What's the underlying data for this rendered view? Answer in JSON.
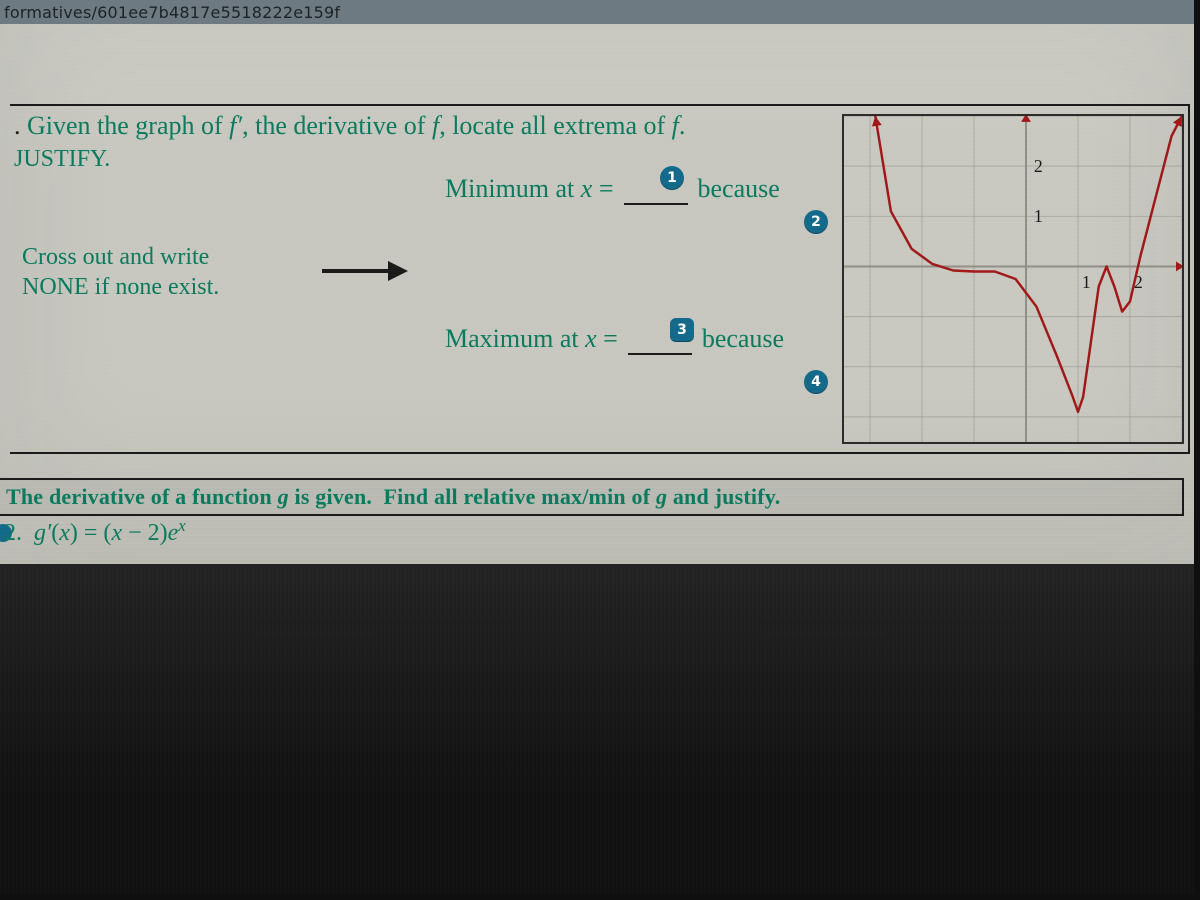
{
  "address_bar": "formatives/601ee7b4817e5518222e159f",
  "p1": {
    "prompt_prefix": ". ",
    "prompt_main": "Given the graph of f′, the derivative of f, locate all extrema of f.",
    "justify": "JUSTIFY.",
    "cross_out_l1": "Cross out and write",
    "cross_out_l2": "NONE if none exist.",
    "min_label": "Minimum at x =",
    "max_label": "Maximum at x =",
    "because": "because",
    "badges": {
      "b1": "1",
      "b2": "2",
      "b3": "3",
      "b4": "4"
    }
  },
  "p2": {
    "header": "The derivative of a function g is given.  Find all relative max/min of g and justify.",
    "num": "2.",
    "eq_lhs": "g′(x) = ",
    "eq_rhs_base": "(x − 2)e",
    "eq_rhs_exp": "x"
  },
  "chart_data": {
    "type": "line",
    "title": "",
    "xlabel": "",
    "ylabel": "",
    "xlim": [
      -3.5,
      3.0
    ],
    "ylim": [
      -3.5,
      3.0
    ],
    "x_ticks": [
      1,
      2
    ],
    "y_ticks": [
      1,
      2
    ],
    "series": [
      {
        "name": "f′(x)",
        "points": [
          [
            -2.9,
            3.0
          ],
          [
            -2.6,
            1.1
          ],
          [
            -2.2,
            0.35
          ],
          [
            -1.8,
            0.05
          ],
          [
            -1.4,
            -0.08
          ],
          [
            -1.0,
            -0.1
          ],
          [
            -0.6,
            -0.1
          ],
          [
            -0.2,
            -0.25
          ],
          [
            0.2,
            -0.8
          ],
          [
            0.6,
            -1.8
          ],
          [
            0.9,
            -2.6
          ],
          [
            1.0,
            -2.9
          ],
          [
            1.1,
            -2.6
          ],
          [
            1.25,
            -1.5
          ],
          [
            1.4,
            -0.4
          ],
          [
            1.55,
            0.0
          ],
          [
            1.7,
            -0.4
          ],
          [
            1.85,
            -0.9
          ],
          [
            2.0,
            -0.7
          ],
          [
            2.2,
            0.2
          ],
          [
            2.5,
            1.4
          ],
          [
            2.8,
            2.6
          ],
          [
            3.0,
            3.0
          ]
        ]
      }
    ]
  }
}
